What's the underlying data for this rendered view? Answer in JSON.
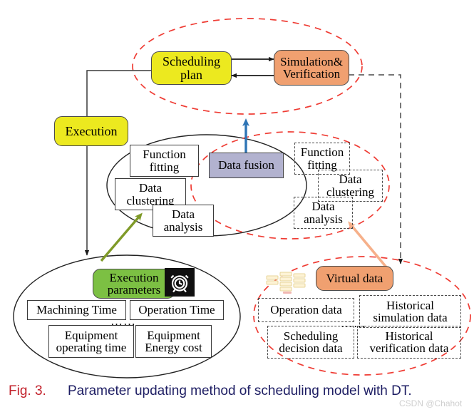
{
  "figure": {
    "caption_label": "Fig. 3.",
    "caption_text": "Parameter updating method of scheduling model with DT.",
    "watermark": "CSDN @Chahot",
    "label_color": "#c2202a",
    "text_color": "#1d1d63"
  },
  "colors": {
    "yellow": "#ece91f",
    "orange": "#f0a070",
    "green": "#7cc043",
    "purple": "#b2b2cf",
    "red_dashed": "#ef3c34",
    "blue_arrow": "#2e74b5",
    "green_arrow": "#7f9a28",
    "orange_arrow": "#f6b08a",
    "black_line": "#3a3a3a"
  },
  "nodes": {
    "scheduling_plan": "Scheduling plan",
    "simulation_verification": "Simulation& Verification",
    "execution": "Execution",
    "data_fusion": "Data fusion",
    "execution_parameters": "Execution parameters",
    "virtual_data": "Virtual data"
  },
  "physical_analysis": {
    "items": [
      "Function fitting",
      "Data clustering",
      "Data analysis"
    ]
  },
  "virtual_analysis": {
    "items": [
      "Function fitting",
      "Data clustering",
      "Data analysis"
    ]
  },
  "execution_parameters_group": {
    "items": [
      "Machining Time",
      "Operation Time",
      "Equipment operating time",
      "Equipment Energy cost"
    ],
    "ellipsis": "……"
  },
  "virtual_data_group": {
    "items": [
      "Operation data",
      "Historical simulation data",
      "Scheduling decision data",
      "Historical verification data"
    ],
    "ellipsis": "……"
  },
  "icons": {
    "clock": "alarm-clock-icon",
    "database": "database-stack-icon"
  }
}
